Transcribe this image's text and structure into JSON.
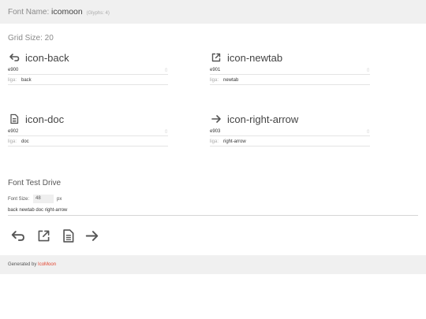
{
  "header": {
    "label": "Font Name:",
    "font_name": "icomoon",
    "glyph_count": "(Glyphs: 4)"
  },
  "grid": {
    "label": "Grid Size: 20"
  },
  "glyphs": [
    {
      "name": "icon-back",
      "code": "e900",
      "liga_label": "liga:",
      "liga": "back",
      "icon": "back-arrow-icon"
    },
    {
      "name": "icon-newtab",
      "code": "e901",
      "liga_label": "liga:",
      "liga": "newtab",
      "icon": "external-link-icon"
    },
    {
      "name": "icon-doc",
      "code": "e902",
      "liga_label": "liga:",
      "liga": "doc",
      "icon": "document-icon"
    },
    {
      "name": "icon-right-arrow",
      "code": "e903",
      "liga_label": "liga:",
      "liga": "right-arrow",
      "icon": "right-arrow-icon"
    }
  ],
  "test_drive": {
    "title": "Font Test Drive",
    "font_size_label": "Font Size:",
    "font_size_value": "48",
    "unit": "px",
    "sample_text": "back newtab doc right-arrow"
  },
  "footer": {
    "prefix": "Generated by",
    "link": "IcoMoon",
    "link_color": "#e2442f"
  },
  "colors": {
    "band": "#f0f0f0",
    "text": "#555555",
    "accent": "#e2442f"
  }
}
